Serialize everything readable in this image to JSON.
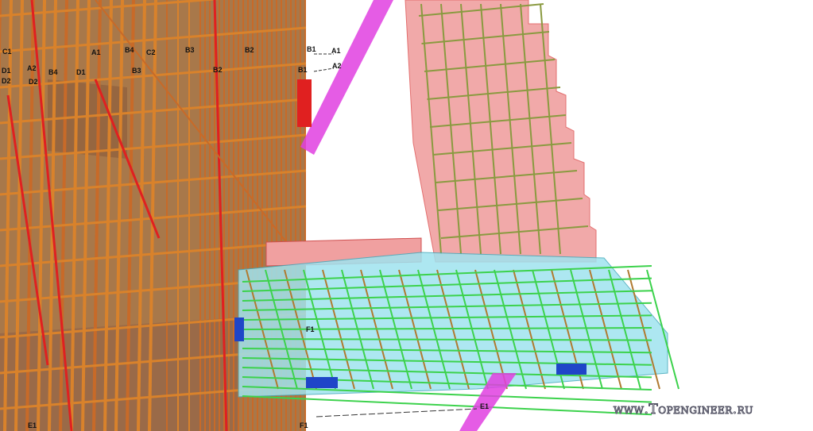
{
  "labels": {
    "c1": "C1",
    "a1": "A1",
    "b4a": "B4",
    "c2": "C2",
    "b3a": "B3",
    "b2a": "B2",
    "b1a": "B1",
    "a1r": "A1",
    "d1a": "D1",
    "a2": "A2",
    "b4b": "B4",
    "d1b": "D1",
    "b3b": "B3",
    "b2b": "B2",
    "b1b": "B1",
    "a2r": "A2",
    "d2a": "D2",
    "d2b": "D2",
    "f1a": "F1",
    "e1a": "E1",
    "f1b": "F1",
    "e1b": "E1"
  },
  "watermark": "www.Topengineer.ru",
  "colors": {
    "rebar": "#d9822b",
    "wall": "#a8784a",
    "stair": "#f0a0a0",
    "slab": "#9fe3ef",
    "beam": "#e040e0",
    "green_rebar": "#3cd24c",
    "blue_part": "#1f45c8"
  }
}
